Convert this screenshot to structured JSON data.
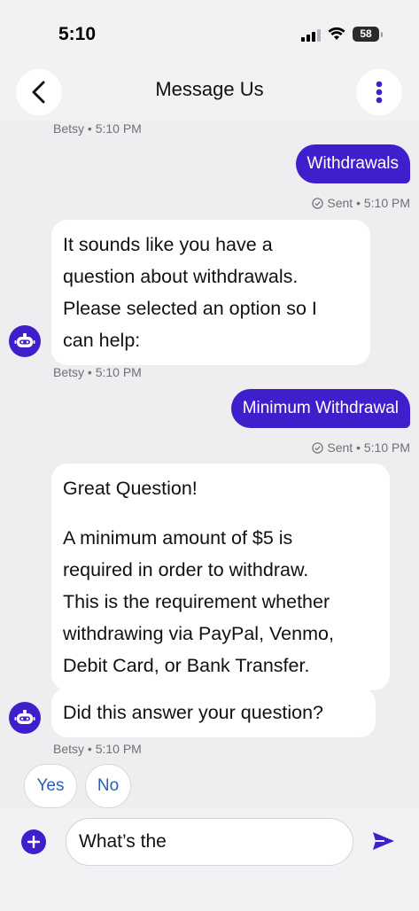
{
  "status_bar": {
    "time": "5:10",
    "battery": "58"
  },
  "header": {
    "title": "Message Us"
  },
  "messages": [
    {
      "type": "meta",
      "text": "Betsy • 5:10 PM"
    },
    {
      "type": "user",
      "text": "Withdrawals",
      "status": "Sent • 5:10 PM"
    },
    {
      "type": "bot",
      "lines": [
        "It sounds like you have a",
        "question about withdrawals.",
        "Please selected an option so I",
        "can help:"
      ],
      "meta": "Betsy • 5:10 PM"
    },
    {
      "type": "user",
      "text": "Minimum Withdrawal",
      "status": "Sent • 5:10 PM"
    },
    {
      "type": "bot",
      "heading": "Great Question!",
      "lines": [
        "A minimum amount of $5 is",
        "required in order to withdraw.",
        "This is the requirement whether",
        "withdrawing via PayPal, Venmo,",
        "Debit Card, or Bank Transfer."
      ]
    },
    {
      "type": "bot",
      "text": "Did this answer your question?",
      "meta": "Betsy • 5:10 PM"
    }
  ],
  "quick_replies": [
    "Yes",
    "No"
  ],
  "composer": {
    "value": "What’s the",
    "accent_color": "#3f1fcc"
  },
  "icons": {
    "back": "chevron-left-icon",
    "more": "more-vertical-icon",
    "bot": "robot-icon",
    "sent": "check-circle-icon",
    "add": "plus-icon",
    "send": "send-icon"
  }
}
